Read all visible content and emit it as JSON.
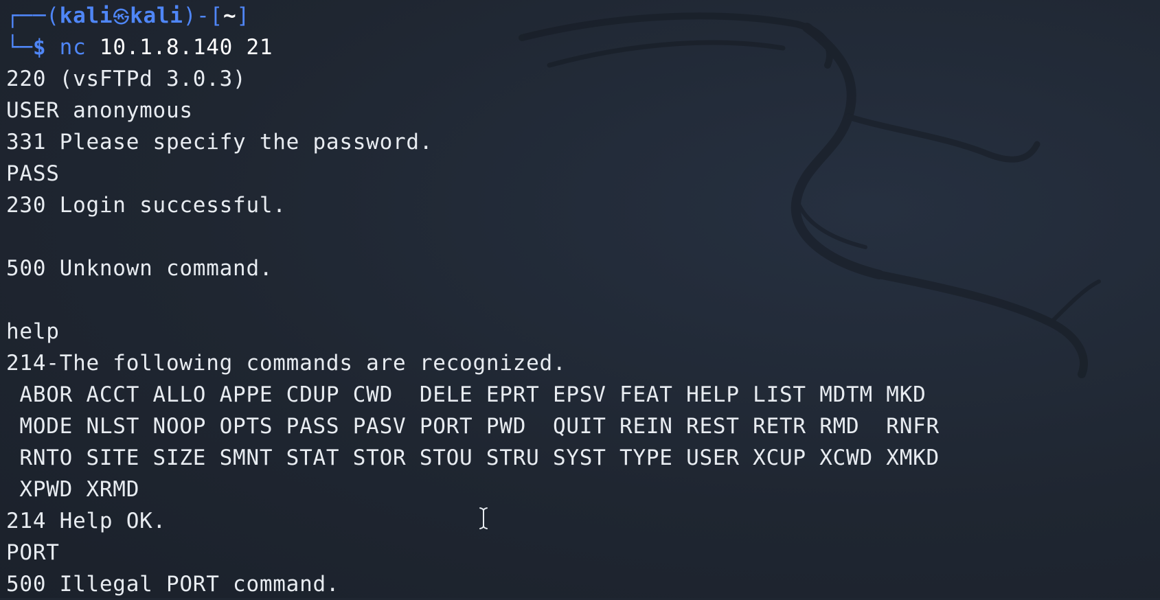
{
  "theme": {
    "background": "#1f2631",
    "text": "#e8ecf1",
    "accent": "#4f86f7"
  },
  "prompt": {
    "frame_top_left": "┌──(",
    "user": "kali",
    "at_icon": "㉿",
    "host": "kali",
    "frame_mid": ")-[",
    "dir": "~",
    "frame_end": "]",
    "frame_bottom_left": "└─",
    "dollar": "$",
    "command": "nc",
    "args": "10.1.8.140 21"
  },
  "output_lines": [
    "220 (vsFTPd 3.0.3)",
    "USER anonymous",
    "331 Please specify the password.",
    "PASS",
    "230 Login successful.",
    "",
    "500 Unknown command.",
    "",
    "help",
    "214-The following commands are recognized.",
    " ABOR ACCT ALLO APPE CDUP CWD  DELE EPRT EPSV FEAT HELP LIST MDTM MKD",
    " MODE NLST NOOP OPTS PASS PASV PORT PWD  QUIT REIN REST RETR RMD  RNFR",
    " RNTO SITE SIZE SMNT STAT STOR STOU STRU SYST TYPE USER XCUP XCWD XMKD",
    " XPWD XRMD",
    "214 Help OK.",
    "PORT",
    "500 Illegal PORT command."
  ],
  "icons": {
    "wallpaper": "kali-dragon-icon",
    "cursor": "text-cursor-icon"
  }
}
